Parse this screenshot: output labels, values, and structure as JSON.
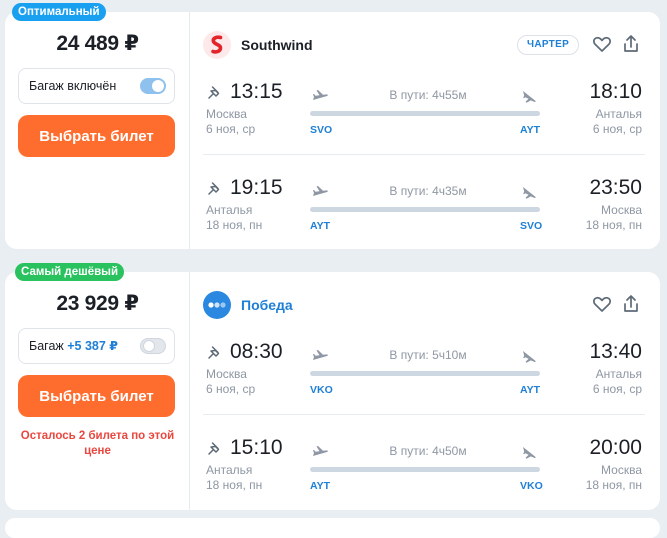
{
  "offers": [
    {
      "badge": "Оптимальный",
      "price": "24 489 ₽",
      "baggage": {
        "label": "Багаж включён",
        "extra": "",
        "enabled": true
      },
      "buy_label": "Выбрать билет",
      "warning": "",
      "airline": {
        "name": "Southwind",
        "logo_icon": "southwind-logo",
        "charter": "ЧАРТЕР"
      },
      "segments": [
        {
          "dep_time": "13:15",
          "dep_city": "Москва",
          "dep_date": "6 ноя, ср",
          "duration": "В пути: 4ч55м",
          "from_code": "SVO",
          "to_code": "AYT",
          "arr_time": "18:10",
          "arr_city": "Анталья",
          "arr_date": "6 ноя, ср"
        },
        {
          "dep_time": "19:15",
          "dep_city": "Анталья",
          "dep_date": "18 ноя, пн",
          "duration": "В пути: 4ч35м",
          "from_code": "AYT",
          "to_code": "SVO",
          "arr_time": "23:50",
          "arr_city": "Москва",
          "arr_date": "18 ноя, пн"
        }
      ]
    },
    {
      "badge": "Самый дешёвый",
      "price": "23 929 ₽",
      "baggage": {
        "label": "Багаж",
        "extra": "+5 387 ₽",
        "enabled": false
      },
      "buy_label": "Выбрать билет",
      "warning": "Осталось 2 билета по этой цене",
      "airline": {
        "name": "Победа",
        "logo_icon": "pobeda-logo",
        "charter": ""
      },
      "segments": [
        {
          "dep_time": "08:30",
          "dep_city": "Москва",
          "dep_date": "6 ноя, ср",
          "duration": "В пути: 5ч10м",
          "from_code": "VKO",
          "to_code": "AYT",
          "arr_time": "13:40",
          "arr_city": "Анталья",
          "arr_date": "6 ноя, ср"
        },
        {
          "dep_time": "15:10",
          "dep_city": "Анталья",
          "dep_date": "18 ноя, пн",
          "duration": "В пути: 4ч50м",
          "from_code": "AYT",
          "to_code": "VKO",
          "arr_time": "20:00",
          "arr_city": "Москва",
          "arr_date": "18 ноя, пн"
        }
      ]
    }
  ],
  "colors": {
    "accent": "#ff6d2e",
    "link": "#1e7fd6",
    "badge_optimal": "#1aa0f0",
    "badge_cheapest": "#2ac25e",
    "warning": "#e9473f"
  }
}
